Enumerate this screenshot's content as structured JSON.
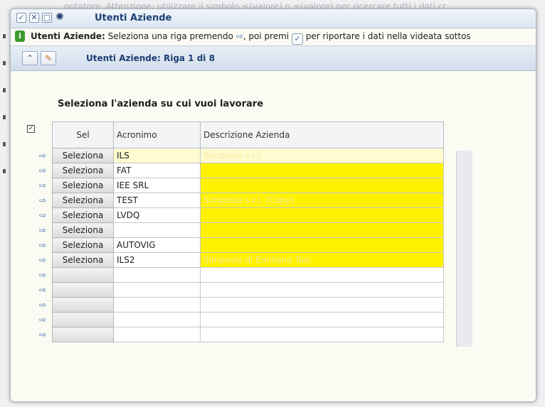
{
  "titlebar": {
    "title": "Utenti Aziende"
  },
  "info": {
    "title": "Utenti Aziende:",
    "text1": " Seleziona una riga premendo ",
    "text2": ", poi premi ",
    "text3": "per riportare i dati nella videata sottos"
  },
  "toolbar": {
    "title": "Utenti Aziende: Riga 1 di 8"
  },
  "heading": "Seleziona l'azienda su cui vuoi lavorare",
  "grid": {
    "columns": [
      "Sel",
      "Acronimo",
      "Descrizione Azienda"
    ],
    "rows": [
      {
        "sel": "Seleziona",
        "acronimo": "ILS",
        "descrizione": "Simposio s.r.l."
      },
      {
        "sel": "Seleziona",
        "acronimo": "FAT",
        "descrizione": ""
      },
      {
        "sel": "Seleziona",
        "acronimo": "IEE SRL",
        "descrizione": ""
      },
      {
        "sel": "Seleziona",
        "acronimo": "TEST",
        "descrizione": "Simposio s.r.l. (Copy)"
      },
      {
        "sel": "Seleziona",
        "acronimo": "LVDQ",
        "descrizione": ""
      },
      {
        "sel": "Seleziona",
        "acronimo": "",
        "descrizione": ""
      },
      {
        "sel": "Seleziona",
        "acronimo": "AUTOVIG",
        "descrizione": ""
      },
      {
        "sel": "Seleziona",
        "acronimo": "ILS2",
        "descrizione": "Simposio di Emiliano Tosi"
      },
      {
        "sel": "",
        "acronimo": "",
        "descrizione": ""
      },
      {
        "sel": "",
        "acronimo": "",
        "descrizione": ""
      },
      {
        "sel": "",
        "acronimo": "",
        "descrizione": ""
      },
      {
        "sel": "",
        "acronimo": "",
        "descrizione": ""
      },
      {
        "sel": "",
        "acronimo": "",
        "descrizione": ""
      }
    ]
  },
  "background": {
    "line1": "ontatore. Attenzione: utilizzare il simbolo ≤(valore) o ≤(valore) per ricercare tutti i dati cr"
  },
  "colors": {
    "highlight": "#fff200",
    "accent": "#1d3f73"
  },
  "icons": {
    "confirm": "check-icon",
    "close": "close-icon",
    "window": "window-icon",
    "settings": "gear-icon",
    "info": "info-icon",
    "select_row": "arrow-icon",
    "collapse": "collapse-icon",
    "edit": "pencil-icon"
  }
}
